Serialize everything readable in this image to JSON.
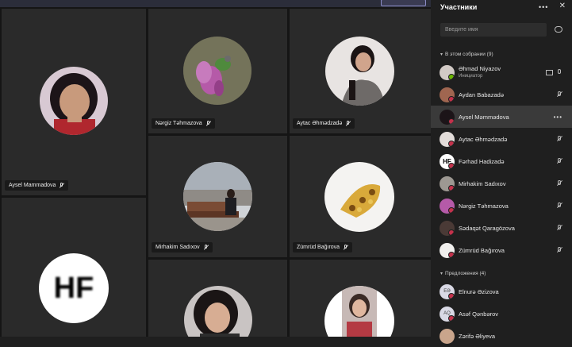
{
  "panel": {
    "title": "Участники",
    "search_placeholder": "Введите имя",
    "in_meeting_label": "В этом собрании (9)",
    "suggestions_label": "Предложения (4)",
    "participants": [
      {
        "name": "Əhmad Niyazov",
        "role": "Инициатор"
      },
      {
        "name": "Aydan Babazadə"
      },
      {
        "name": "Aysel Məmmədova"
      },
      {
        "name": "Aytac Əhmədzadə"
      },
      {
        "name": "Fərhad Hadizadə",
        "initials": "HF"
      },
      {
        "name": "Mirhakim Sadıxov"
      },
      {
        "name": "Nərgiz Təhmazova"
      },
      {
        "name": "Sədaqət Qaragözova"
      },
      {
        "name": "Zümrüd Bağırova"
      }
    ],
    "suggestions": [
      {
        "name": "Elnurə Əzizova",
        "initials": "EƏ"
      },
      {
        "name": "Asəf Qənbərov",
        "initials": "AQ"
      },
      {
        "name": "Zərifə Əliyeva"
      }
    ]
  },
  "tiles": {
    "aysel": "Aysel Mammadova",
    "nargiz": "Nərgiz Təhmazova",
    "aytac": "Aytac Əhmədzadə",
    "mirhakim": "Mirhakim Sadıxov",
    "zumrud": "Zümrüd Bağırova",
    "hf_initials": "HF"
  },
  "colors": {
    "status_red": "#c4314b",
    "panel_bg": "#1f1f1f",
    "tile_bg": "#2a2a2a",
    "topbar": "#2b2d3a"
  },
  "icons": [
    "mic-off-icon",
    "more-icon",
    "close-icon",
    "share-link-icon",
    "screen-share-icon",
    "chevron-down-icon"
  ]
}
